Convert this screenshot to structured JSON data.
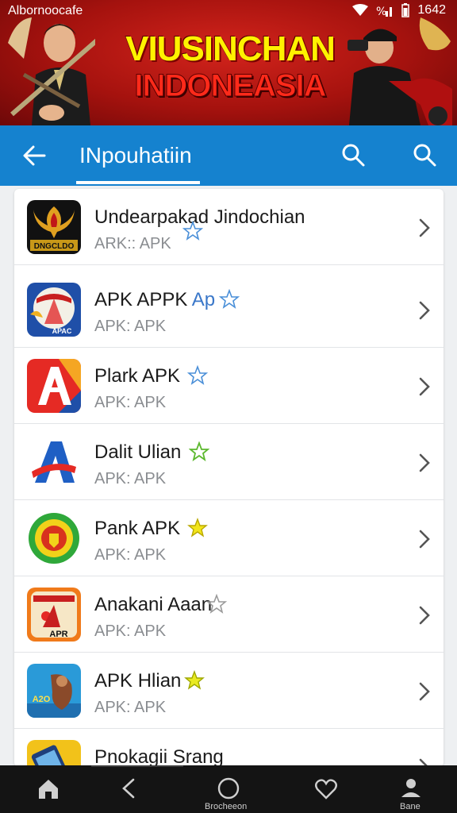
{
  "status_bar": {
    "carrier": "Albornoocafe",
    "time": "1642"
  },
  "banner": {
    "line1": "VIUSINCHAN",
    "line2": "INDONEASIA"
  },
  "app_bar": {
    "title": "INpouhatiin"
  },
  "apps": [
    {
      "name": "Undearpakad Jindochian",
      "sub": "ARK:: APK",
      "icon_label": "DNGCLDO",
      "star_color": "#4a8fd8",
      "star_fill": false
    },
    {
      "name": "APK APPK",
      "name_suffix": "Ap",
      "sub": "APK: APK",
      "icon_label": "APAC",
      "star_color": "#4a8fd8",
      "star_fill": false
    },
    {
      "name": "Plark APK",
      "sub": "APK: APK",
      "icon_label": "",
      "star_color": "#4a8fd8",
      "star_fill": false
    },
    {
      "name": "Dalit Ulian",
      "sub": "APK: APK",
      "icon_label": "",
      "star_color": "#5cb82e",
      "star_fill": false
    },
    {
      "name": "Pank APK",
      "sub": "APK: APK",
      "icon_label": "",
      "star_color": "#d6c400",
      "star_fill": true
    },
    {
      "name": "Anakani Aaan",
      "sub": "APK: APK",
      "icon_label": "APR",
      "star_color": "#9a9a9a",
      "star_fill": false
    },
    {
      "name": "APK Hlian",
      "sub": "APK: APK",
      "icon_label": "A2O",
      "star_color": "#c7d100",
      "star_fill": true
    },
    {
      "name": "Pnokagii Srang",
      "sub": "",
      "icon_label": "",
      "star_color": "#9a9a9a",
      "star_fill": false
    }
  ],
  "bottom_nav": {
    "center_label": "Brocheeon",
    "right_label": "Bane"
  },
  "colors": {
    "app_bar": "#1582cf",
    "banner_red": "#b5150f",
    "banner_yellow": "#fff200",
    "nav_bg": "#141414"
  }
}
